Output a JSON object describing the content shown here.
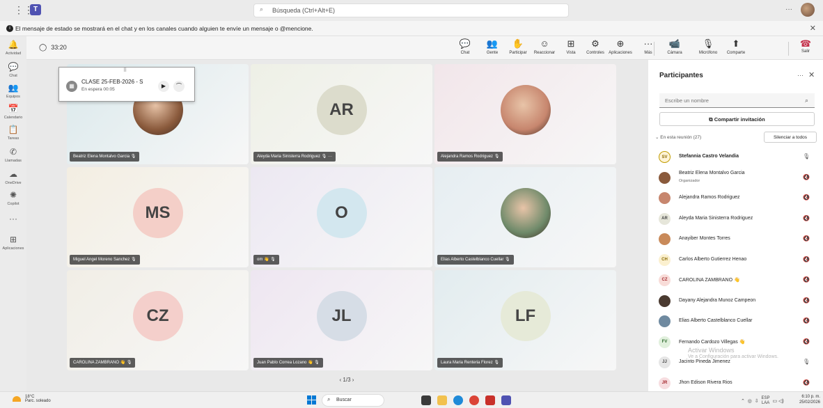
{
  "topbar": {
    "search_placeholder": "Búsqueda (Ctrl+Alt+E)",
    "more": "···"
  },
  "banner": {
    "text": "El mensaje de estado se mostrará en el chat y en los canales cuando alguien te envíe un mensaje o @mencione.",
    "close": "✕"
  },
  "rail": [
    {
      "label": "Actividad",
      "icon": "bell-icon",
      "glyph": "🔔",
      "badge": "2"
    },
    {
      "label": "Chat",
      "icon": "chat-icon",
      "glyph": "💬",
      "badge": "1"
    },
    {
      "label": "Equipos",
      "icon": "teams-icon",
      "glyph": "👥",
      "badge": ""
    },
    {
      "label": "Calendario",
      "icon": "calendar-icon",
      "glyph": "📅",
      "badge": ""
    },
    {
      "label": "Tareas",
      "icon": "tasks-icon",
      "glyph": "📋",
      "badge": ""
    },
    {
      "label": "Llamadas",
      "icon": "phone-icon",
      "glyph": "✆",
      "badge": ""
    },
    {
      "label": "OneDrive",
      "icon": "cloud-icon",
      "glyph": "☁",
      "badge": ""
    },
    {
      "label": "Copilot",
      "icon": "copilot-icon",
      "glyph": "✺",
      "badge": ""
    },
    {
      "label": "",
      "icon": "more-icon",
      "glyph": "···",
      "badge": ""
    },
    {
      "label": "Aplicaciones",
      "icon": "apps-icon",
      "glyph": "⊞",
      "badge": ""
    }
  ],
  "meeting": {
    "timer": "33:20",
    "controls": [
      {
        "label": "Chat",
        "glyph": "💬",
        "badge": ""
      },
      {
        "label": "Gente",
        "glyph": "👥",
        "badge": "1"
      },
      {
        "label": "Participar",
        "glyph": "✋",
        "badge": ""
      },
      {
        "label": "Reaccionar",
        "glyph": "☺",
        "badge": ""
      },
      {
        "label": "Vista",
        "glyph": "⊞",
        "badge": ""
      },
      {
        "label": "Controles",
        "glyph": "⚙",
        "badge": ""
      },
      {
        "label": "Aplicaciones",
        "glyph": "⊕",
        "badge": ""
      },
      {
        "label": "Más",
        "glyph": "···",
        "badge": ""
      },
      {
        "label": "Cámara",
        "glyph": "📹",
        "badge": ""
      },
      {
        "label": "Micrófono",
        "glyph": "🎙",
        "badge": ""
      },
      {
        "label": "Comparte",
        "glyph": "⬆",
        "badge": ""
      }
    ],
    "leave": "Salir"
  },
  "callcard": {
    "title": "CLASE 25-FEB-2026 - S",
    "status": "En espera  00:05"
  },
  "tiles": [
    {
      "name": "Beatriz Elena Montalvo Garcia 🎙",
      "initials": "",
      "bg": "#dbe9ec",
      "circle": "",
      "photo": "#8a5a3c"
    },
    {
      "name": "Aleyda Maria Sinisterra Rodriguez 🎙 ···",
      "initials": "AR",
      "bg": "#eef0e6",
      "circle": "#dcdccc",
      "photo": ""
    },
    {
      "name": "Alejandra Ramos Rodriguez 🎙",
      "initials": "",
      "bg": "#f2e6ea",
      "circle": "",
      "photo": "#c7866e"
    },
    {
      "name": "Miguel Angel Moreno Sanchez 🎙",
      "initials": "MS",
      "bg": "#f3eee2",
      "circle": "#f4cfc8",
      "photo": ""
    },
    {
      "name": "om 👋 🎙",
      "initials": "O",
      "bg": "#ece8f2",
      "circle": "#d3e7ef",
      "photo": ""
    },
    {
      "name": "Elias Alberto Castelblanco Cuellar 🎙",
      "initials": "",
      "bg": "#e6eef2",
      "circle": "",
      "photo": "#6f8a6a"
    },
    {
      "name": "CAROLINA ZAMBRANO 👋 🎙",
      "initials": "CZ",
      "bg": "#f1eee6",
      "circle": "#f4cfcb",
      "photo": ""
    },
    {
      "name": "Juan Pablo Correa Lozano 👋 🎙",
      "initials": "JL",
      "bg": "#eee6f1",
      "circle": "#d6dde6",
      "photo": ""
    },
    {
      "name": "Laura Maria Renteria Florez 🎙",
      "initials": "LF",
      "bg": "#e2ecef",
      "circle": "#e6ead8",
      "photo": ""
    }
  ],
  "pager": "‹  1/3  ›",
  "panel": {
    "title": "Participantes",
    "input_placeholder": "Escribe un nombre",
    "invite": "Compartir invitación",
    "in_meeting": "En esta reunión (27)",
    "mute_all": "Silenciar a todos",
    "people": [
      {
        "name": "Stefannia Castro Velandia",
        "role": "",
        "initials": "SV",
        "av_bg": "#fff3d6",
        "av_fg": "#8a6a00",
        "mic": "🎙",
        "bold": true
      },
      {
        "name": "Beatriz Elena Montalvo Garcia",
        "role": "Organizador",
        "initials": "",
        "av_bg": "#8a5a3c",
        "av_fg": "#fff",
        "mic": "🔇",
        "bold": false
      },
      {
        "name": "Alejandra Ramos Rodriguez",
        "role": "",
        "initials": "",
        "av_bg": "#c7866e",
        "av_fg": "#fff",
        "mic": "🔇",
        "bold": false
      },
      {
        "name": "Aleyda Maria Sinisterra Rodriguez",
        "role": "",
        "initials": "AR",
        "av_bg": "#e6e6da",
        "av_fg": "#444",
        "mic": "🔇",
        "bold": false
      },
      {
        "name": "Anayiber Montes Torres",
        "role": "",
        "initials": "",
        "av_bg": "#c98a5a",
        "av_fg": "#fff",
        "mic": "🔇",
        "bold": false
      },
      {
        "name": "Carlos Alberto Gutierrez Henao",
        "role": "",
        "initials": "CH",
        "av_bg": "#fbf0cf",
        "av_fg": "#8a6a00",
        "mic": "🔇",
        "bold": false
      },
      {
        "name": "CAROLINA ZAMBRANO 👋",
        "role": "",
        "initials": "CZ",
        "av_bg": "#f8dcd8",
        "av_fg": "#a4262c",
        "mic": "🔇",
        "bold": false
      },
      {
        "name": "Dayany Alejandra Munoz Campeon",
        "role": "",
        "initials": "",
        "av_bg": "#4a3a30",
        "av_fg": "#fff",
        "mic": "🔇",
        "bold": false
      },
      {
        "name": "Elias Alberto Castelblanco Cuellar",
        "role": "",
        "initials": "",
        "av_bg": "#6f8aa0",
        "av_fg": "#fff",
        "mic": "🔇",
        "bold": false
      },
      {
        "name": "Fernando Cardozo Villegas 👋",
        "role": "",
        "initials": "FV",
        "av_bg": "#e1f0dd",
        "av_fg": "#2f6a2f",
        "mic": "🔇",
        "bold": false
      },
      {
        "name": "Jacinto Pineda Jimenez",
        "role": "",
        "initials": "JJ",
        "av_bg": "#e6e6e6",
        "av_fg": "#444",
        "mic": "🎙",
        "bold": false
      },
      {
        "name": "Jhon Edison Rivera Rios",
        "role": "",
        "initials": "JR",
        "av_bg": "#f7dde0",
        "av_fg": "#a4262c",
        "mic": "🔇",
        "bold": false
      }
    ]
  },
  "watermark": {
    "line1": "Activar Windows",
    "line2": "Ve a Configuración para activar Windows."
  },
  "taskbar": {
    "temp": "18°C",
    "weather": "Parc. soleado",
    "search": "Buscar",
    "lang1": "ESP",
    "lang2": "LAA",
    "time": "6:10 p. m.",
    "date": "25/02/2026"
  }
}
